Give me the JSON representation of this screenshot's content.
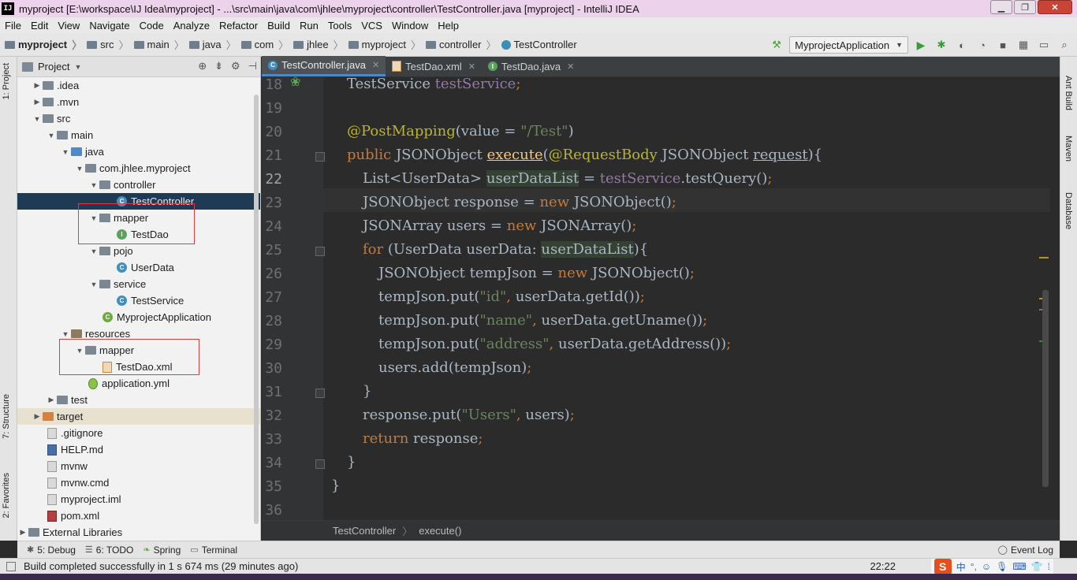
{
  "window": {
    "title": "myproject [E:\\workspace\\IJ Idea\\myproject] - ...\\src\\main\\java\\com\\jhlee\\myproject\\controller\\TestController.java [myproject] - IntelliJ IDEA",
    "app_icon": "IJ",
    "minimize": "▁",
    "maximize": "❐",
    "close": "✕"
  },
  "menu": [
    "File",
    "Edit",
    "View",
    "Navigate",
    "Code",
    "Analyze",
    "Refactor",
    "Build",
    "Run",
    "Tools",
    "VCS",
    "Window",
    "Help"
  ],
  "breadcrumb": [
    "myproject",
    "src",
    "main",
    "java",
    "com",
    "jhlee",
    "myproject",
    "controller",
    "TestController"
  ],
  "run_config": "MyprojectApplication",
  "left_stripe": {
    "project": "1: Project",
    "structure": "7: Structure",
    "favorites": "2: Favorites"
  },
  "right_stripe": {
    "ant": "Ant Build",
    "maven": "Maven",
    "database": "Database"
  },
  "project_panel": {
    "title": "Project",
    "items": [
      {
        "label": ".idea"
      },
      {
        "label": ".mvn"
      },
      {
        "label": "src"
      },
      {
        "label": "main"
      },
      {
        "label": "java"
      },
      {
        "label": "com.jhlee.myproject"
      },
      {
        "label": "controller"
      },
      {
        "label": "TestController"
      },
      {
        "label": "mapper"
      },
      {
        "label": "TestDao"
      },
      {
        "label": "pojo"
      },
      {
        "label": "UserData"
      },
      {
        "label": "service"
      },
      {
        "label": "TestService"
      },
      {
        "label": "MyprojectApplication"
      },
      {
        "label": "resources"
      },
      {
        "label": "mapper"
      },
      {
        "label": "TestDao.xml"
      },
      {
        "label": "application.yml"
      },
      {
        "label": "test"
      },
      {
        "label": "target"
      },
      {
        "label": ".gitignore"
      },
      {
        "label": "HELP.md"
      },
      {
        "label": "mvnw"
      },
      {
        "label": "mvnw.cmd"
      },
      {
        "label": "myproject.iml"
      },
      {
        "label": "pom.xml"
      },
      {
        "label": "External Libraries"
      }
    ]
  },
  "tabs": [
    "TestController.java",
    "TestDao.xml",
    "TestDao.java"
  ],
  "line_numbers": [
    "18",
    "19",
    "20",
    "21",
    "22",
    "23",
    "24",
    "25",
    "26",
    "27",
    "28",
    "29",
    "30",
    "31",
    "32",
    "33",
    "34",
    "35",
    "36"
  ],
  "code": {
    "l18a": "TestService ",
    "l18b": "testService",
    "l18c": ";",
    "l20a": "@PostMapping",
    "l20b": "(value = ",
    "l20c": "\"/Test\"",
    "l20d": ")",
    "l21a": "public ",
    "l21b": "JSONObject ",
    "l21c": "execute",
    "l21d": "(",
    "l21e": "@RequestBody ",
    "l21f": "JSONObject ",
    "l21g": "request",
    "l21h": "){",
    "l22a": "List<UserData> ",
    "l22b": "userDataList",
    "l22c": " = ",
    "l22d": "testService",
    "l22e": ".testQuery()",
    "l22f": ";",
    "l23a": "JSONObject response = ",
    "l23b": "new ",
    "l23c": "JSONObject()",
    "l23d": ";",
    "l24a": "JSONArray users = ",
    "l24b": "new ",
    "l24c": "JSONArray()",
    "l24d": ";",
    "l25a": "for ",
    "l25b": "(UserData userData: ",
    "l25c": "userDataList",
    "l25d": "){",
    "l26a": "JSONObject tempJson = ",
    "l26b": "new ",
    "l26c": "JSONObject()",
    "l26d": ";",
    "l27a": "tempJson.put(",
    "l27b": "\"id\"",
    "l27c": ", ",
    "l27d": "userData.getId())",
    "l27e": ";",
    "l28a": "tempJson.put(",
    "l28b": "\"name\"",
    "l28c": ", ",
    "l28d": "userData.getUname())",
    "l28e": ";",
    "l29a": "tempJson.put(",
    "l29b": "\"address\"",
    "l29c": ", ",
    "l29d": "userData.getAddress())",
    "l29e": ";",
    "l30a": "users.add(tempJson)",
    "l30b": ";",
    "l31": "}",
    "l32a": "response.put(",
    "l32b": "\"Users\"",
    "l32c": ", ",
    "l32d": "users)",
    "l32e": ";",
    "l33a": "return ",
    "l33b": "response",
    "l33c": ";",
    "l34": "}",
    "l35": "}"
  },
  "editor_breadcrumb": [
    "TestController",
    "execute()"
  ],
  "bottom_tools": [
    "5: Debug",
    "6: TODO",
    "Spring",
    "Terminal",
    "Event Log"
  ],
  "status": {
    "message": "Build completed successfully in 1 s 674 ms (29 minutes ago)",
    "position": "22:22",
    "ime_char": "中"
  },
  "colors": {
    "keyword": "#cc7832",
    "annotation": "#bbb529",
    "string": "#6a8759",
    "field": "#9876aa",
    "selection": "#1f3a55",
    "highlight_box": "#e23c3c"
  }
}
